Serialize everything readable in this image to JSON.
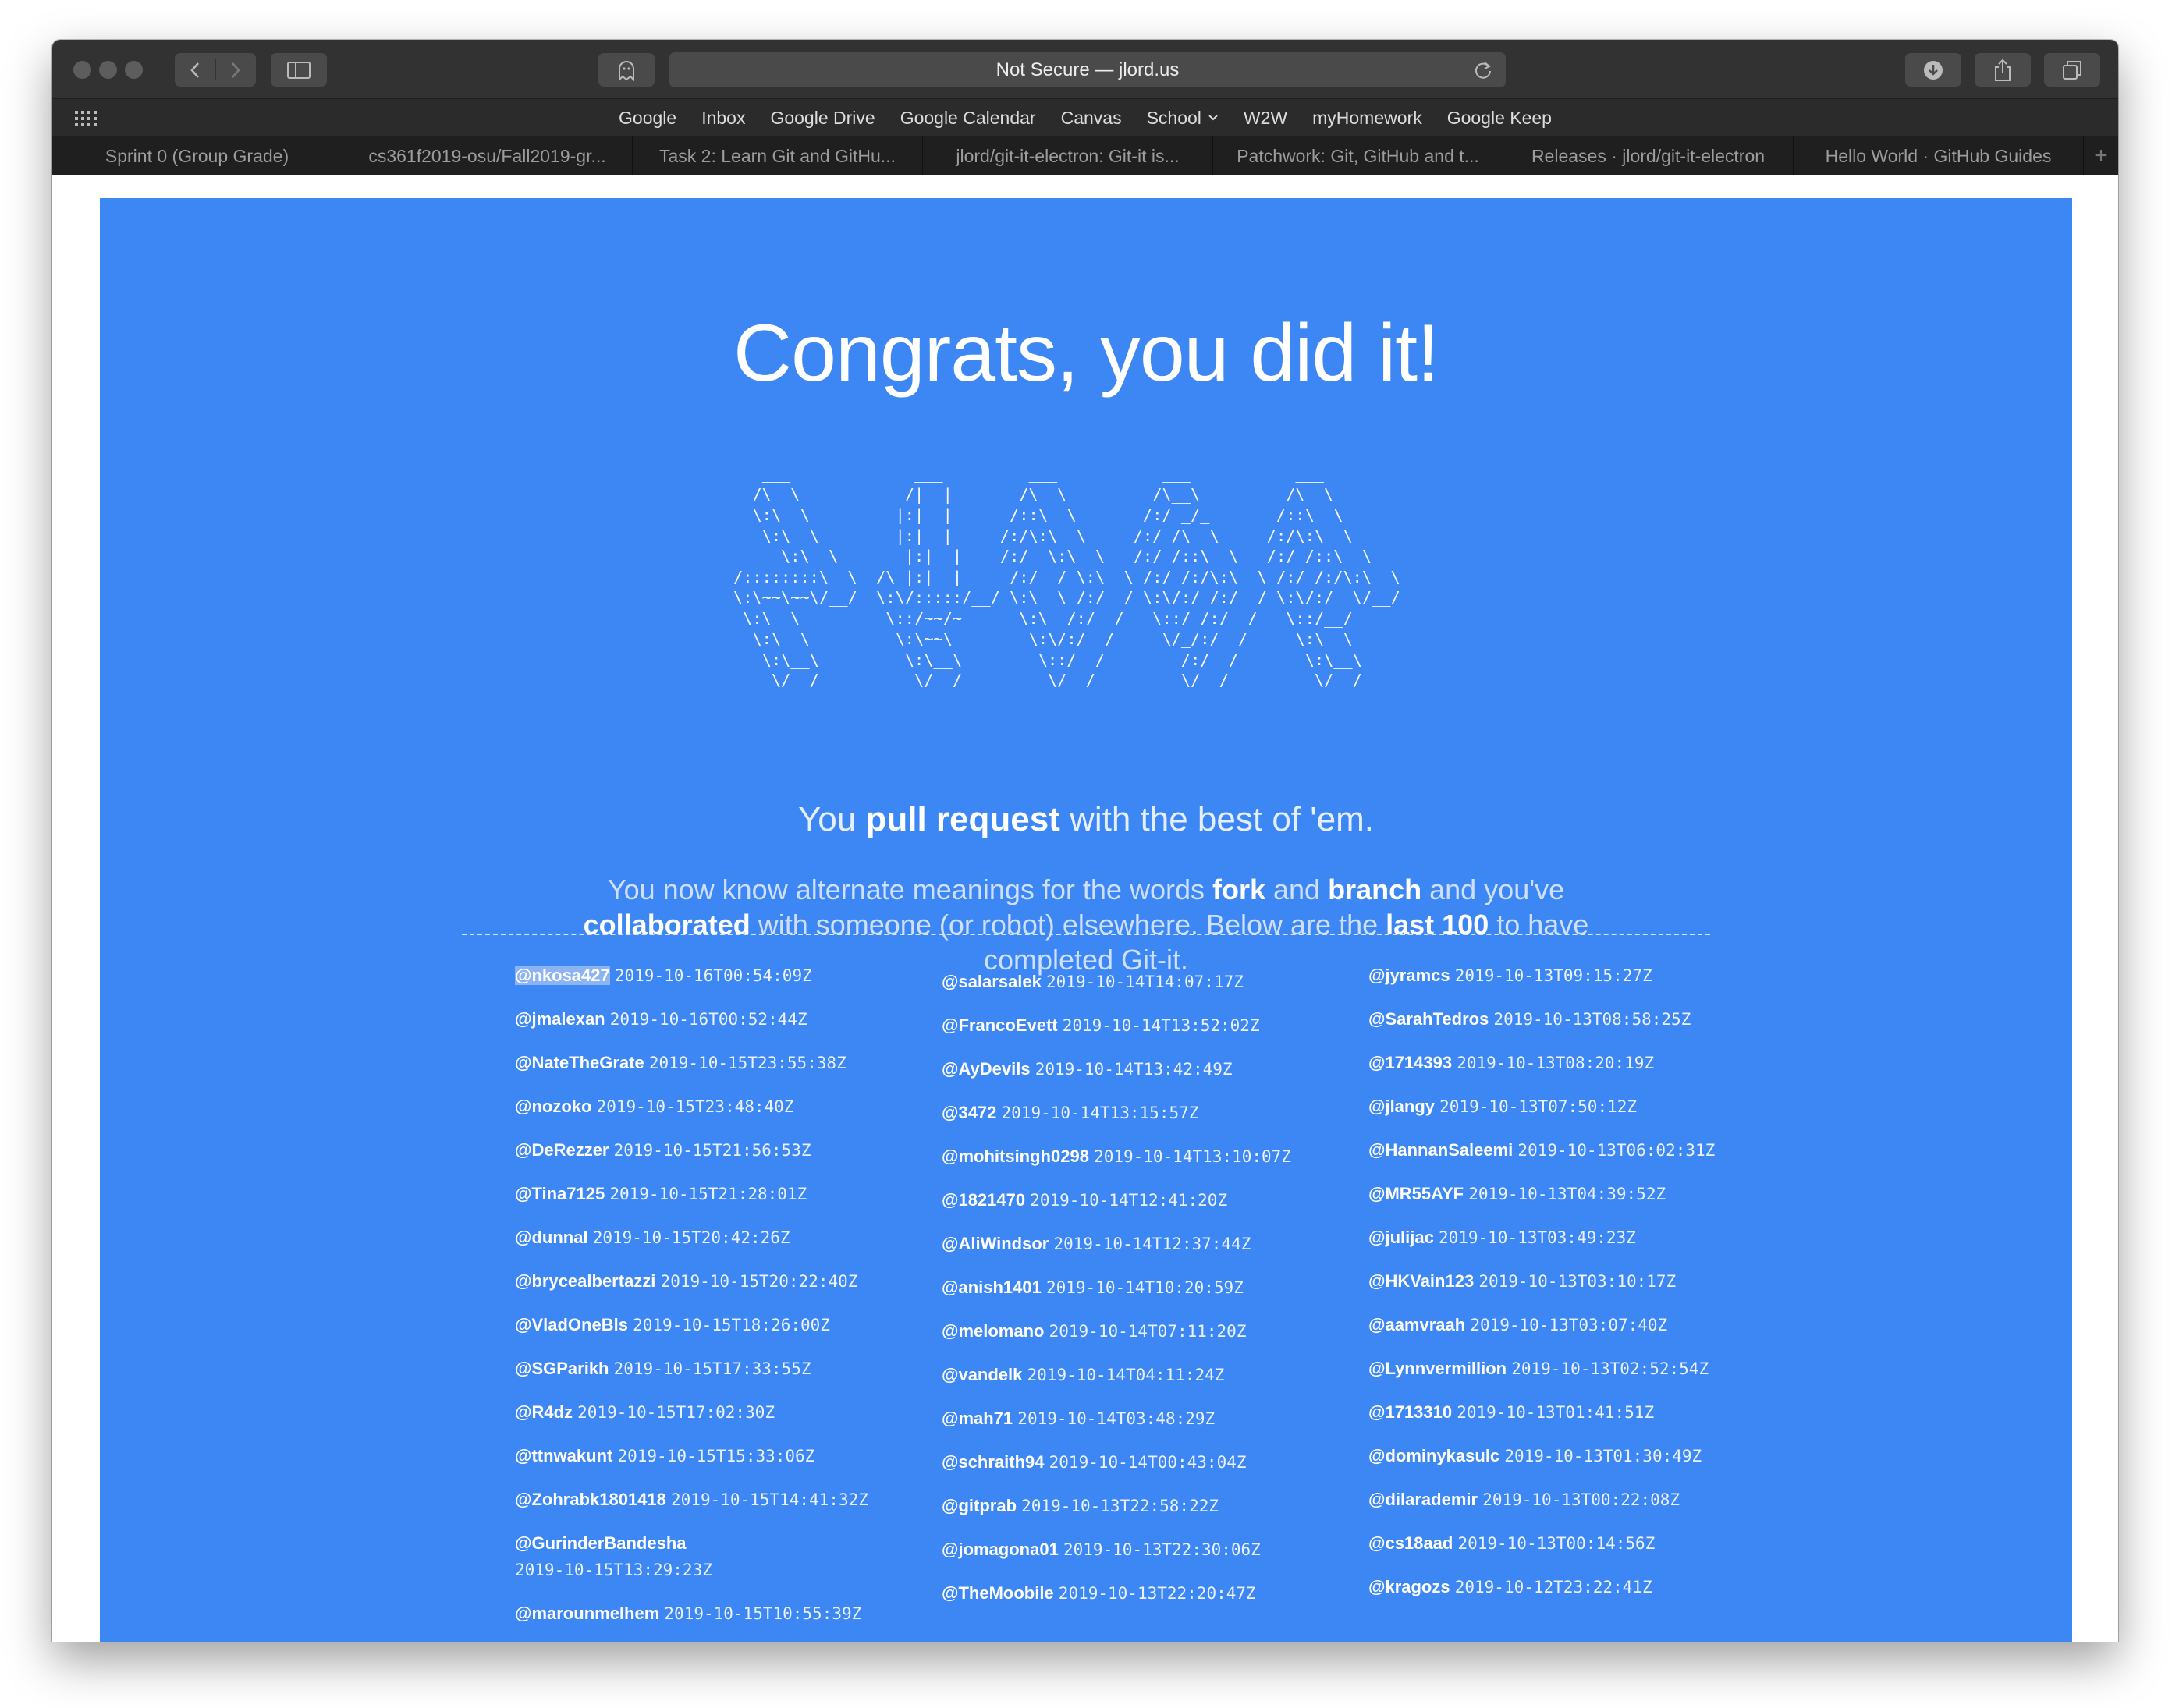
{
  "browser": {
    "address": "Not Secure — jlord.us",
    "bookmarks": [
      "Google",
      "Inbox",
      "Google Drive",
      "Google Calendar",
      "Canvas",
      "School",
      "W2W",
      "myHomework",
      "Google Keep"
    ],
    "tabs": [
      "Sprint 0 (Group Grade)",
      "cs361f2019-osu/Fall2019-gr...",
      "Task 2: Learn Git and GitHu...",
      "jlord/git-it-electron: Git-it is...",
      "Patchwork: Git, GitHub and t...",
      "Releases · jlord/git-it-electron",
      "Hello World · GitHub Guides"
    ],
    "new_tab": "+"
  },
  "page": {
    "headline": "Congrats, you did it!",
    "ascii_art": "   ___             ___         ___           ___           ___   \n  /\\  \\           /|  |       /\\  \\         /\\__\\         /\\  \\  \n  \\:\\  \\         |:|  |      /::\\  \\       /:/ _/_       /::\\  \\ \n   \\:\\  \\        |:|  |     /:/\\:\\  \\     /:/ /\\  \\     /:/\\:\\  \\\n_____\\:\\  \\     __|:|  |    /:/  \\:\\  \\   /:/ /::\\  \\   /:/ /::\\  \\\n/::::::::\\__\\  /\\ |:|__|____ /:/__/ \\:\\__\\ /:/_/:/\\:\\__\\ /:/_/:/\\:\\__\\\n\\:\\~~\\~~\\/__/  \\:\\/:::::/__/ \\:\\  \\ /:/  / \\:\\/:/ /:/  / \\:\\/:/  \\/__/\n \\:\\  \\         \\::/~~/~      \\:\\  /:/  /   \\::/ /:/  /   \\::/__/    \n  \\:\\  \\         \\:\\~~\\        \\:\\/:/  /     \\/_/:/  /     \\:\\  \\    \n   \\:\\__\\         \\:\\__\\        \\::/  /        /:/  /       \\:\\__\\   \n    \\/__/          \\/__/         \\/__/         \\/__/         \\/__/   ",
    "tagline": {
      "pre": "You ",
      "bold": "pull request",
      "post": " with the best of 'em."
    },
    "intro": {
      "t1": "You now know alternate meanings for the words ",
      "b1": "fork",
      "t2": " and ",
      "b2": "branch",
      "t3": " and you've ",
      "b3": "collaborated",
      "t4": " with someone (or robot) elsewhere. Below are the ",
      "b4": "last 100",
      "t5": " to have completed Git-it."
    },
    "completions": [
      [
        {
          "user": "@nkosa427",
          "time": "2019-10-16T00:54:09Z"
        },
        {
          "user": "@jmalexan",
          "time": "2019-10-16T00:52:44Z"
        },
        {
          "user": "@NateTheGrate",
          "time": "2019-10-15T23:55:38Z"
        },
        {
          "user": "@nozoko",
          "time": "2019-10-15T23:48:40Z"
        },
        {
          "user": "@DeRezzer",
          "time": "2019-10-15T21:56:53Z"
        },
        {
          "user": "@Tina7125",
          "time": "2019-10-15T21:28:01Z"
        },
        {
          "user": "@dunnal",
          "time": "2019-10-15T20:42:26Z"
        },
        {
          "user": "@brycealbertazzi",
          "time": "2019-10-15T20:22:40Z"
        },
        {
          "user": "@VladOneBls",
          "time": "2019-10-15T18:26:00Z"
        },
        {
          "user": "@SGParikh",
          "time": "2019-10-15T17:33:55Z"
        },
        {
          "user": "@R4dz",
          "time": "2019-10-15T17:02:30Z"
        },
        {
          "user": "@ttnwakunt",
          "time": "2019-10-15T15:33:06Z"
        },
        {
          "user": "@Zohrabk1801418",
          "time": "2019-10-15T14:41:32Z"
        },
        {
          "user": "@GurinderBandesha",
          "time": "2019-10-15T13:29:23Z"
        },
        {
          "user": "@marounmelhem",
          "time": "2019-10-15T10:55:39Z"
        }
      ],
      [
        {
          "user": "@salarsalek",
          "time": "2019-10-14T14:07:17Z"
        },
        {
          "user": "@FrancoEvett",
          "time": "2019-10-14T13:52:02Z"
        },
        {
          "user": "@AyDevils",
          "time": "2019-10-14T13:42:49Z"
        },
        {
          "user": "@3472",
          "time": "2019-10-14T13:15:57Z"
        },
        {
          "user": "@mohitsingh0298",
          "time": "2019-10-14T13:10:07Z"
        },
        {
          "user": "@1821470",
          "time": "2019-10-14T12:41:20Z"
        },
        {
          "user": "@AliWindsor",
          "time": "2019-10-14T12:37:44Z"
        },
        {
          "user": "@anish1401",
          "time": "2019-10-14T10:20:59Z"
        },
        {
          "user": "@melomano",
          "time": "2019-10-14T07:11:20Z"
        },
        {
          "user": "@vandelk",
          "time": "2019-10-14T04:11:24Z"
        },
        {
          "user": "@mah71",
          "time": "2019-10-14T03:48:29Z"
        },
        {
          "user": "@schraith94",
          "time": "2019-10-14T00:43:04Z"
        },
        {
          "user": "@gitprab",
          "time": "2019-10-13T22:58:22Z"
        },
        {
          "user": "@jomagona01",
          "time": "2019-10-13T22:30:06Z"
        },
        {
          "user": "@TheMoobile",
          "time": "2019-10-13T22:20:47Z"
        }
      ],
      [
        {
          "user": "@jyramcs",
          "time": "2019-10-13T09:15:27Z"
        },
        {
          "user": "@SarahTedros",
          "time": "2019-10-13T08:58:25Z"
        },
        {
          "user": "@1714393",
          "time": "2019-10-13T08:20:19Z"
        },
        {
          "user": "@jlangy",
          "time": "2019-10-13T07:50:12Z"
        },
        {
          "user": "@HannanSaleemi",
          "time": "2019-10-13T06:02:31Z"
        },
        {
          "user": "@MR55AYF",
          "time": "2019-10-13T04:39:52Z"
        },
        {
          "user": "@julijac",
          "time": "2019-10-13T03:49:23Z"
        },
        {
          "user": "@HKVain123",
          "time": "2019-10-13T03:10:17Z"
        },
        {
          "user": "@aamvraah",
          "time": "2019-10-13T03:07:40Z"
        },
        {
          "user": "@Lynnvermillion",
          "time": "2019-10-13T02:52:54Z"
        },
        {
          "user": "@1713310",
          "time": "2019-10-13T01:41:51Z"
        },
        {
          "user": "@dominykasulc",
          "time": "2019-10-13T01:30:49Z"
        },
        {
          "user": "@dilarademir",
          "time": "2019-10-13T00:22:08Z"
        },
        {
          "user": "@cs18aad",
          "time": "2019-10-13T00:14:56Z"
        },
        {
          "user": "@kragozs",
          "time": "2019-10-12T23:22:41Z"
        }
      ]
    ],
    "selected_user": "@nkosa427"
  }
}
